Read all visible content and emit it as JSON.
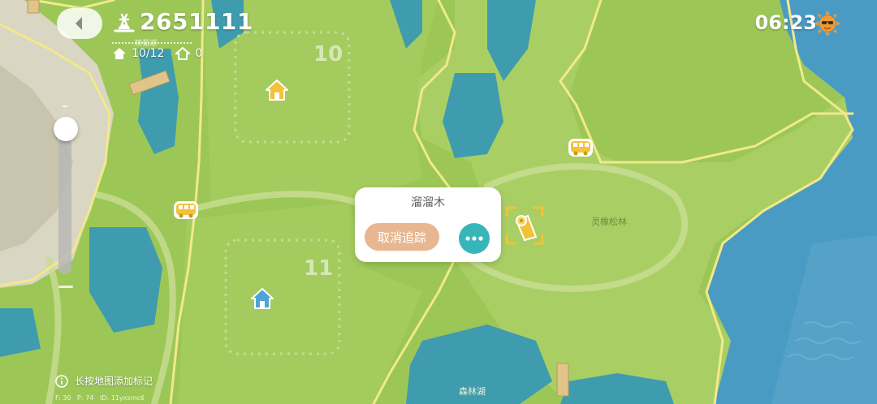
{
  "hud": {
    "money": "2651111",
    "houses_count": "10/12",
    "homes_count": "0",
    "time": "06:23"
  },
  "popup": {
    "title": "溜溜木",
    "untrack_label": "取消追踪"
  },
  "map": {
    "plot_a_number": "10",
    "plot_b_number": "11",
    "area_label_forest": "灵橡松林",
    "lake_label_top": "映菊湖",
    "lake_label_bottom": "森林湖"
  },
  "footer": {
    "hint": "长按地图添加标记",
    "debug_f": "F: 30",
    "debug_p": "P: 74",
    "debug_id": "ID: 11yxsmc6"
  },
  "colors": {
    "grass": "#9cc757",
    "water": "#3f9cae",
    "sea": "#4a9bc4",
    "road": "#f2e98a",
    "accent_untrack": "#e8b791",
    "accent_more": "#37b6ba",
    "house_yellow": "#f3c23a",
    "house_blue": "#4fa3d8"
  },
  "icons": [
    "back-arrow-icon",
    "money-icon",
    "house-icon",
    "home-icon",
    "sun-icon",
    "bus-icon",
    "tracker-icon",
    "info-icon",
    "more-icon"
  ]
}
